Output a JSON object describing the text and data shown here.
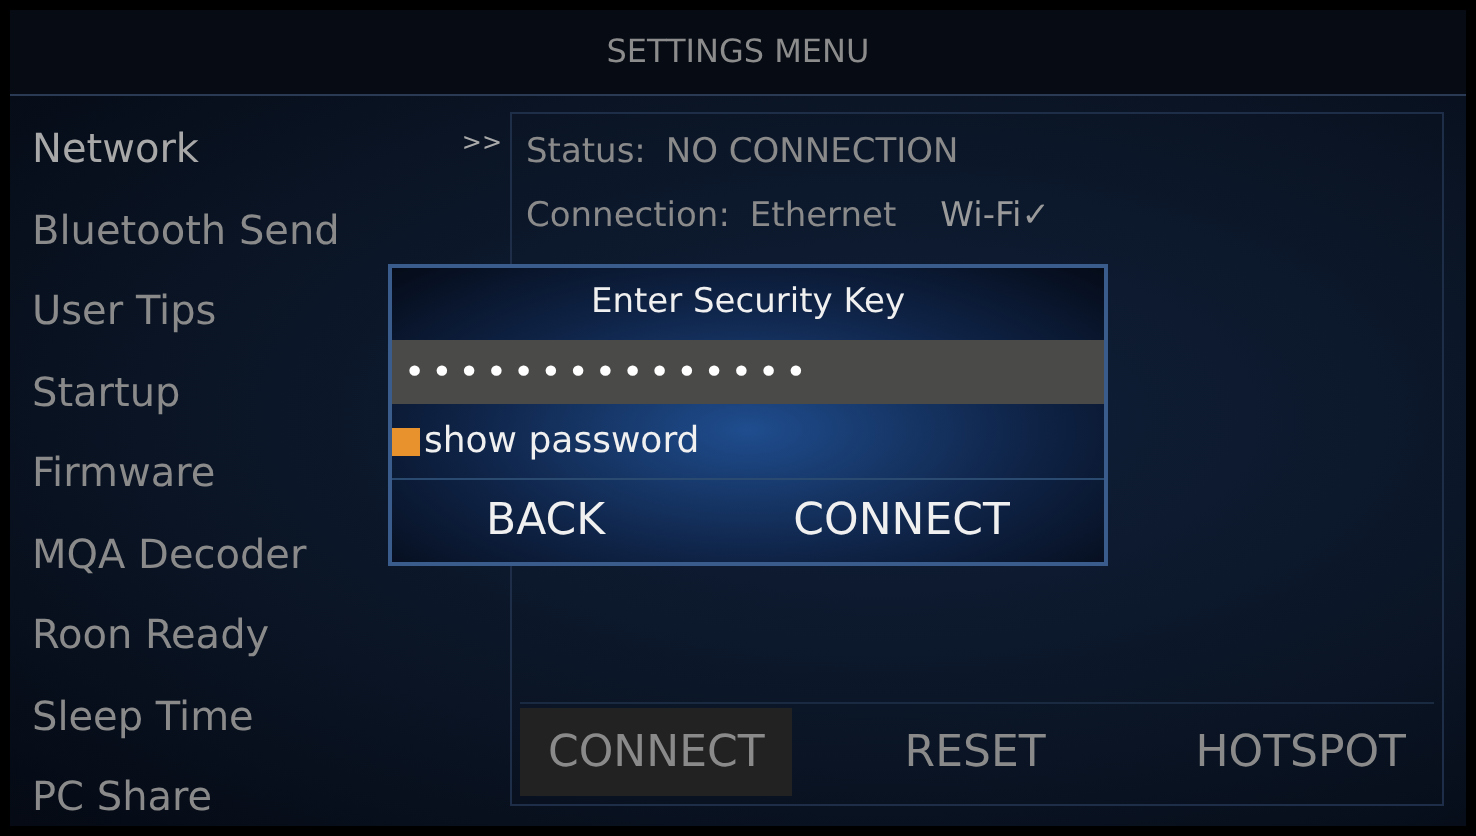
{
  "window": {
    "title": "SETTINGS MENU"
  },
  "sidebar": {
    "items": [
      {
        "label": "Network",
        "selected": true,
        "marker": ">>"
      },
      {
        "label": "Bluetooth Send",
        "selected": false
      },
      {
        "label": "User Tips",
        "selected": false
      },
      {
        "label": "Startup",
        "selected": false
      },
      {
        "label": "Firmware",
        "selected": false
      },
      {
        "label": "MQA Decoder",
        "selected": false
      },
      {
        "label": "Roon Ready",
        "selected": false
      },
      {
        "label": "Sleep Time",
        "selected": false
      },
      {
        "label": "PC Share",
        "selected": false
      }
    ]
  },
  "network": {
    "status_label": "Status:",
    "status": "NO CONNECTION",
    "connection_label": "Connection:",
    "options": [
      {
        "label": "Ethernet",
        "selected": false
      },
      {
        "label": "Wi-Fi",
        "selected": true,
        "check": "✓"
      }
    ],
    "buttons": [
      {
        "label": "CONNECT",
        "selected": true
      },
      {
        "label": "RESET",
        "selected": false
      },
      {
        "label": "HOTSPOT",
        "selected": false
      }
    ]
  },
  "dialog": {
    "title": "Enter Security Key",
    "password": "•••••••••••••••",
    "show_password": {
      "label": "show password",
      "checked": true
    },
    "buttons": [
      "BACK",
      "CONNECT"
    ]
  }
}
